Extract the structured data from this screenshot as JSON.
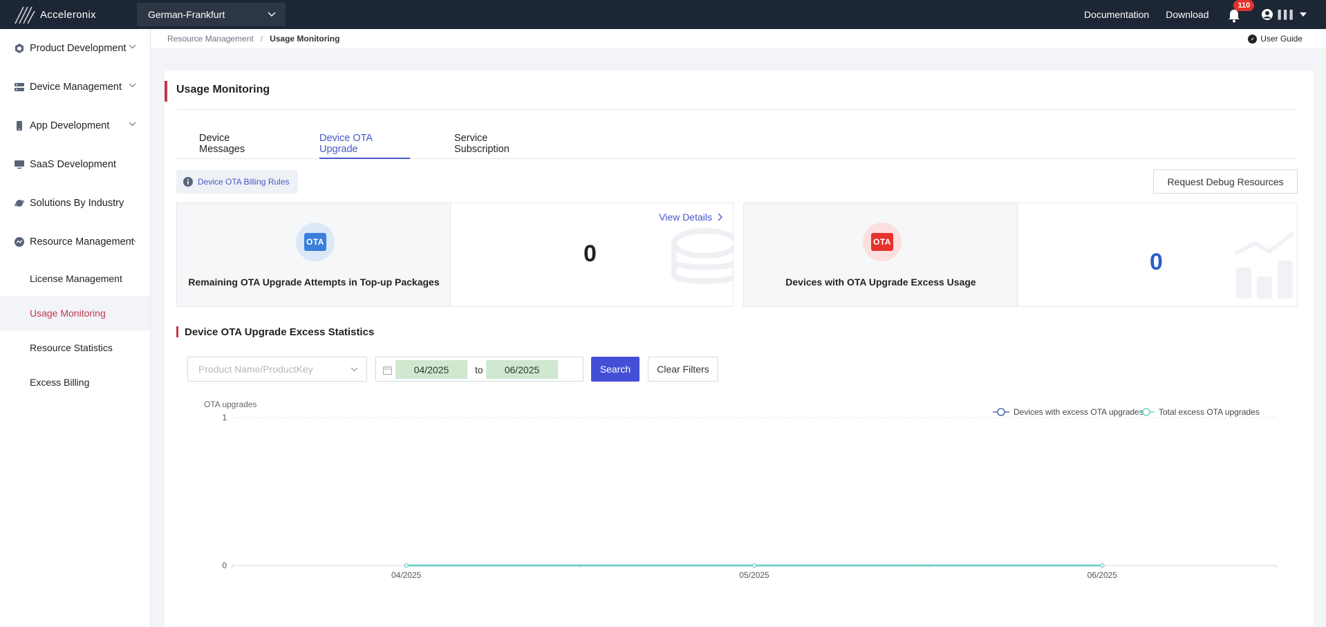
{
  "topbar": {
    "brand": "Acceleronix",
    "region": "German-Frankfurt",
    "links": [
      "Documentation",
      "Download"
    ],
    "notification_count": "110",
    "user_name": "▌▌▌"
  },
  "sidebar": {
    "items": [
      {
        "label": "Product Development",
        "icon": "cube-icon"
      },
      {
        "label": "Device Management",
        "icon": "server-icon"
      },
      {
        "label": "App Development",
        "icon": "phone-icon"
      },
      {
        "label": "SaaS Development",
        "icon": "monitor-icon"
      },
      {
        "label": "Solutions By Industry",
        "icon": "planet-icon"
      },
      {
        "label": "Resource Management",
        "icon": "gauge-icon"
      }
    ],
    "sub_items": [
      "License Management",
      "Usage Monitoring",
      "Resource Statistics",
      "Excess Billing"
    ],
    "active_sub": "Usage Monitoring"
  },
  "breadcrumb": {
    "parent": "Resource Management",
    "separator": "/",
    "current": "Usage Monitoring",
    "user_guide": "User Guide"
  },
  "page": {
    "title": "Usage Monitoring",
    "tabs": [
      "Device Messages",
      "Device OTA Upgrade",
      "Service Subscription"
    ],
    "active_tab": "Device OTA Upgrade",
    "rules_label": "Device OTA Billing Rules",
    "debug_button": "Request Debug Resources"
  },
  "stats": [
    {
      "label": "Remaining OTA Upgrade Attempts in Top-up Packages",
      "value": "0",
      "link": "View Details",
      "icon_text": "OTA",
      "color": "#3a7fd9"
    },
    {
      "label": "Devices with OTA Upgrade Excess Usage",
      "value": "0",
      "icon_text": "OTA",
      "color": "#e5322d"
    }
  ],
  "section": {
    "title": "Device OTA Upgrade Excess Statistics",
    "product_placeholder": "Product Name/ProductKey",
    "date_from": "04/2025",
    "date_to": "06/2025",
    "to_label": "to",
    "search_label": "Search",
    "clear_label": "Clear Filters"
  },
  "chart_data": {
    "type": "line",
    "ylabel": "OTA upgrades",
    "categories": [
      "04/2025",
      "05/2025",
      "06/2025"
    ],
    "ylim": [
      0,
      1
    ],
    "yticks": [
      "0",
      "1"
    ],
    "legend_position": "top-right",
    "series": [
      {
        "name": "Devices with excess OTA upgrades",
        "values": [
          0,
          0,
          0
        ],
        "color": "#4a6ab0"
      },
      {
        "name": "Total excess OTA upgrades",
        "values": [
          0,
          0,
          0
        ],
        "color": "#6fd3c8"
      }
    ]
  }
}
